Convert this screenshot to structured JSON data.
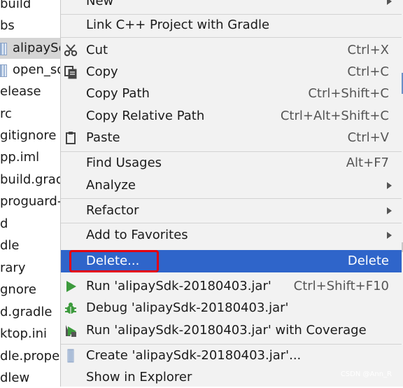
{
  "project_tree": {
    "items": [
      {
        "text": "build"
      },
      {
        "text": "bs"
      },
      {
        "text": "alipaySdk",
        "selected": true,
        "icon": "jar-file-icon"
      },
      {
        "text": "open_sdk",
        "icon": "jar-file-icon"
      },
      {
        "text": "elease"
      },
      {
        "text": "rc"
      },
      {
        "text": "gitignore"
      },
      {
        "text": "pp.iml"
      },
      {
        "text": "build.gradle"
      },
      {
        "text": "proguard-rules"
      },
      {
        "text": "d"
      },
      {
        "text": "dle"
      },
      {
        "text": "rary"
      },
      {
        "text": "gnore"
      },
      {
        "text": "d.gradle"
      },
      {
        "text": "ktop.ini"
      },
      {
        "text": "dle.properties"
      },
      {
        "text": "dlew"
      }
    ]
  },
  "context_menu": {
    "items": [
      {
        "label": "New",
        "shortcut": "",
        "submenu": true
      },
      {
        "label": "Link C++ Project with Gradle",
        "shortcut": "",
        "submenu": false
      },
      {
        "label": "Cut",
        "shortcut": "Ctrl+X",
        "icon": "scissors-icon"
      },
      {
        "label": "Copy",
        "shortcut": "Ctrl+C",
        "icon": "copy-icon"
      },
      {
        "label": "Copy Path",
        "shortcut": "Ctrl+Shift+C"
      },
      {
        "label": "Copy Relative Path",
        "shortcut": "Ctrl+Alt+Shift+C"
      },
      {
        "label": "Paste",
        "shortcut": "Ctrl+V",
        "icon": "clipboard-icon"
      },
      {
        "label": "Find Usages",
        "shortcut": "Alt+F7"
      },
      {
        "label": "Analyze",
        "shortcut": "",
        "submenu": true
      },
      {
        "label": "Refactor",
        "shortcut": "",
        "submenu": true
      },
      {
        "label": "Add to Favorites",
        "shortcut": "",
        "submenu": true
      },
      {
        "label": "Delete...",
        "shortcut": "Delete",
        "active": true
      },
      {
        "label": "Run 'alipaySdk-20180403.jar'",
        "shortcut": "Ctrl+Shift+F10",
        "icon": "run-icon"
      },
      {
        "label": "Debug 'alipaySdk-20180403.jar'",
        "shortcut": "",
        "icon": "debug-bug-icon"
      },
      {
        "label": "Run 'alipaySdk-20180403.jar' with Coverage",
        "shortcut": "",
        "icon": "run-with-coverage-icon"
      },
      {
        "label": "Create 'alipaySdk-20180403.jar'...",
        "shortcut": "",
        "icon": "jar-file-icon"
      },
      {
        "label": "Show in Explorer",
        "shortcut": ""
      }
    ]
  },
  "watermark": "CSDN @Ann_R",
  "colors": {
    "menu_bg": "#f2f2f2",
    "active_bg": "#2f65ca",
    "highlight_box": "#e3000f",
    "run_green": "#3c9a3c"
  }
}
